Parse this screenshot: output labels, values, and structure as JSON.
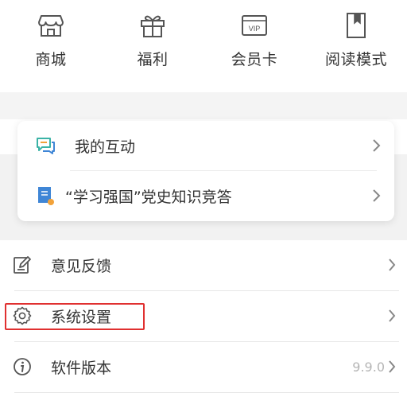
{
  "quick_actions": [
    {
      "label": "商城",
      "icon": "shop-icon"
    },
    {
      "label": "福利",
      "icon": "gift-icon"
    },
    {
      "label": "会员卡",
      "icon": "vip-card-icon",
      "badge": "VIP"
    },
    {
      "label": "阅读模式",
      "icon": "bookmark-icon"
    }
  ],
  "card": {
    "items": [
      {
        "label": "我的互动",
        "icon": "chat-icon"
      },
      {
        "label": "“学习强国”党史知识竞答",
        "icon": "quiz-icon"
      }
    ]
  },
  "settings": {
    "feedback_label": "意见反馈",
    "system_settings_label": "系统设置",
    "version_label": "软件版本",
    "version_value": "9.9.0"
  },
  "colors": {
    "highlight": "#e03030",
    "card_icon_teal": "#3bb3a6",
    "card_icon_blue": "#3f86d6",
    "card_icon_orange": "#f2a23a"
  }
}
